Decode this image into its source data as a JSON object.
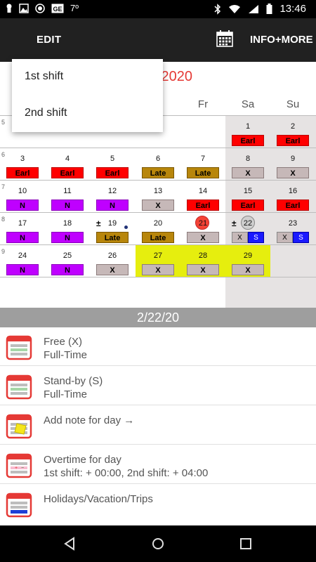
{
  "status_bar": {
    "temperature": "7º",
    "time": "13:46",
    "icons": [
      "keyhole-icon",
      "image-icon",
      "circle-icon",
      "ge-icon",
      "bluetooth-icon",
      "wifi-icon",
      "signal-icon",
      "battery-icon"
    ]
  },
  "toolbar": {
    "edit_label": "EDIT",
    "calendar_icon": "calendar-grid-icon",
    "info_label": "INFO+MORE"
  },
  "dropdown": {
    "items": [
      "1st shift",
      "2nd shift"
    ]
  },
  "calendar": {
    "month_title_visible": "y  2020",
    "weekdays": [
      "Fr",
      "Sa",
      "Su"
    ],
    "colors": {
      "Earl": "#ff0000",
      "Late": "#b8860b",
      "N": "#bf00ff",
      "X": "#c6b8b8",
      "S": "#1a1aff",
      "highlight": "#e6ee0e",
      "weekend": "#e6e3e3"
    },
    "weeks": [
      {
        "week_num": "5",
        "days": [
          {
            "col": 5,
            "day": "1",
            "shift": "Earl"
          },
          {
            "col": 6,
            "day": "2",
            "shift": "Earl"
          }
        ]
      },
      {
        "week_num": "6",
        "days": [
          {
            "col": 0,
            "day": "3",
            "shift": "Earl"
          },
          {
            "col": 1,
            "day": "4",
            "shift": "Earl"
          },
          {
            "col": 2,
            "day": "5",
            "shift": "Earl"
          },
          {
            "col": 3,
            "day": "6",
            "shift": "Late"
          },
          {
            "col": 4,
            "day": "7",
            "shift": "Late"
          },
          {
            "col": 5,
            "day": "8",
            "shift": "X"
          },
          {
            "col": 6,
            "day": "9",
            "shift": "X"
          }
        ]
      },
      {
        "week_num": "7",
        "days": [
          {
            "col": 0,
            "day": "10",
            "shift": "N"
          },
          {
            "col": 1,
            "day": "11",
            "shift": "N"
          },
          {
            "col": 2,
            "day": "12",
            "shift": "N"
          },
          {
            "col": 3,
            "day": "13",
            "shift": "X"
          },
          {
            "col": 4,
            "day": "14",
            "shift": "Earl"
          },
          {
            "col": 5,
            "day": "15",
            "shift": "Earl"
          },
          {
            "col": 6,
            "day": "16",
            "shift": "Earl"
          }
        ]
      },
      {
        "week_num": "8",
        "days": [
          {
            "col": 0,
            "day": "17",
            "shift": "N"
          },
          {
            "col": 1,
            "day": "18",
            "shift": "N"
          },
          {
            "col": 2,
            "day": "19",
            "shift": "Late",
            "mark": "±",
            "dot": true
          },
          {
            "col": 3,
            "day": "20",
            "shift": "Late"
          },
          {
            "col": 4,
            "day": "21",
            "shift": "X",
            "today": true
          },
          {
            "col": 5,
            "day": "22",
            "split": [
              "X",
              "S"
            ],
            "mark": "±",
            "selected": true
          },
          {
            "col": 6,
            "day": "23",
            "split": [
              "X",
              "S"
            ]
          }
        ]
      },
      {
        "week_num": "9",
        "days": [
          {
            "col": 0,
            "day": "24",
            "shift": "N"
          },
          {
            "col": 1,
            "day": "25",
            "shift": "N"
          },
          {
            "col": 2,
            "day": "26",
            "shift": "X"
          },
          {
            "col": 3,
            "day": "27",
            "shift": "X",
            "highlight": true
          },
          {
            "col": 4,
            "day": "28",
            "shift": "X",
            "highlight": true
          },
          {
            "col": 5,
            "day": "29",
            "shift": "X",
            "highlight": true
          }
        ]
      }
    ]
  },
  "detail": {
    "date": "2/22/20",
    "items": [
      {
        "title": "Free (X)",
        "subtitle": "Full-Time",
        "icon": "shift-calendar-icon"
      },
      {
        "title": "Stand-by (S)",
        "subtitle": "Full-Time",
        "icon": "shift-calendar-icon"
      },
      {
        "title": "Add note for day  →",
        "subtitle": "",
        "icon": "note-calendar-icon"
      },
      {
        "title": "Overtime for day",
        "subtitle": "1st shift: + 00:00, 2nd shift: + 04:00",
        "icon": "overtime-calendar-icon"
      },
      {
        "title": "Holidays/Vacation/Trips",
        "subtitle": "",
        "icon": "holiday-calendar-icon"
      }
    ]
  },
  "navbar": {
    "icons": [
      "back-icon",
      "home-icon",
      "recents-icon"
    ]
  }
}
